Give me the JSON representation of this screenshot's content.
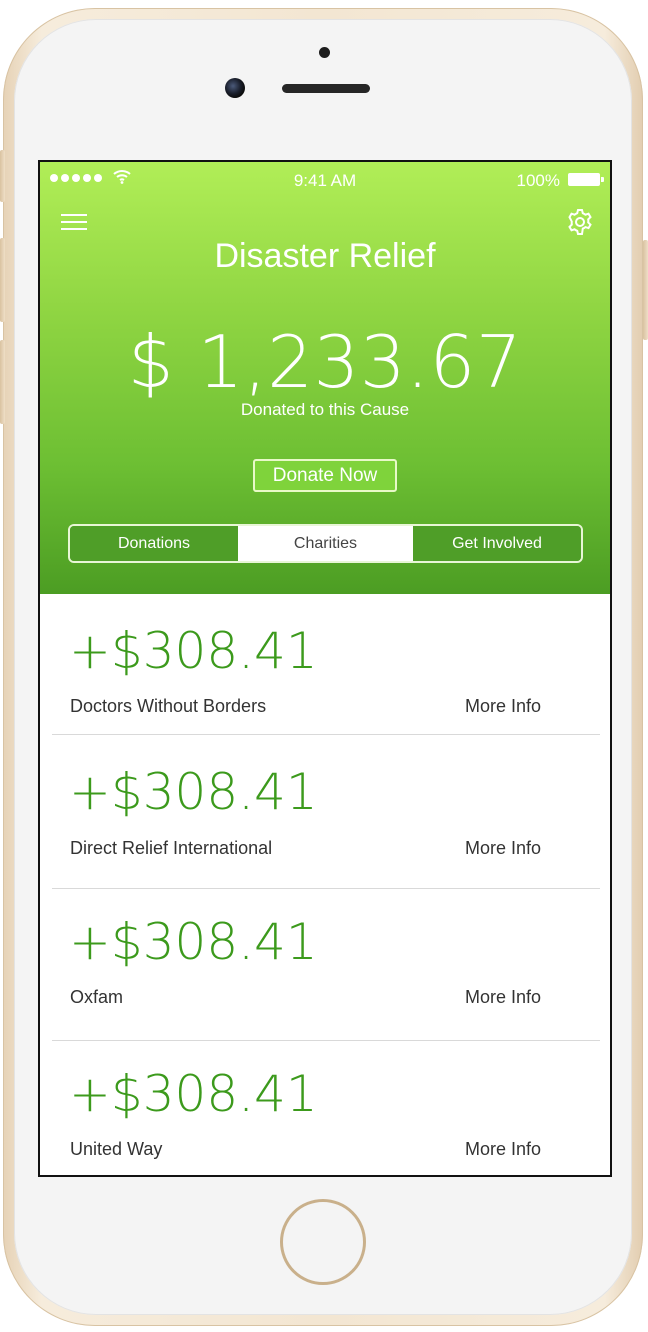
{
  "status_bar": {
    "time": "9:41 AM",
    "battery": "100%"
  },
  "header": {
    "title": "Disaster Relief",
    "amount": "$ 1,233.67",
    "amount_label": "Donated to this Cause",
    "donate_label": "Donate Now"
  },
  "tabs": [
    {
      "label": "Donations",
      "active": false
    },
    {
      "label": "Charities",
      "active": true
    },
    {
      "label": "Get Involved",
      "active": false
    }
  ],
  "charities": [
    {
      "amount": "+$308.41",
      "name": "Doctors Without Borders",
      "link": "More Info"
    },
    {
      "amount": "+$308.41",
      "name": "Direct Relief International",
      "link": "More Info"
    },
    {
      "amount": "+$308.41",
      "name": "Oxfam",
      "link": "More Info"
    },
    {
      "amount": "+$308.41",
      "name": "United Way",
      "link": "More Info"
    }
  ],
  "colors": {
    "accent_green": "#3c9a1c",
    "header_top": "#b1ee57",
    "header_bottom": "#4c9d23",
    "tab_green": "#4f9e28"
  },
  "icons": {
    "menu": "hamburger-menu-icon",
    "settings": "gear-icon",
    "wifi": "wifi-icon",
    "battery": "battery-icon",
    "signal": "signal-dots-icon"
  }
}
